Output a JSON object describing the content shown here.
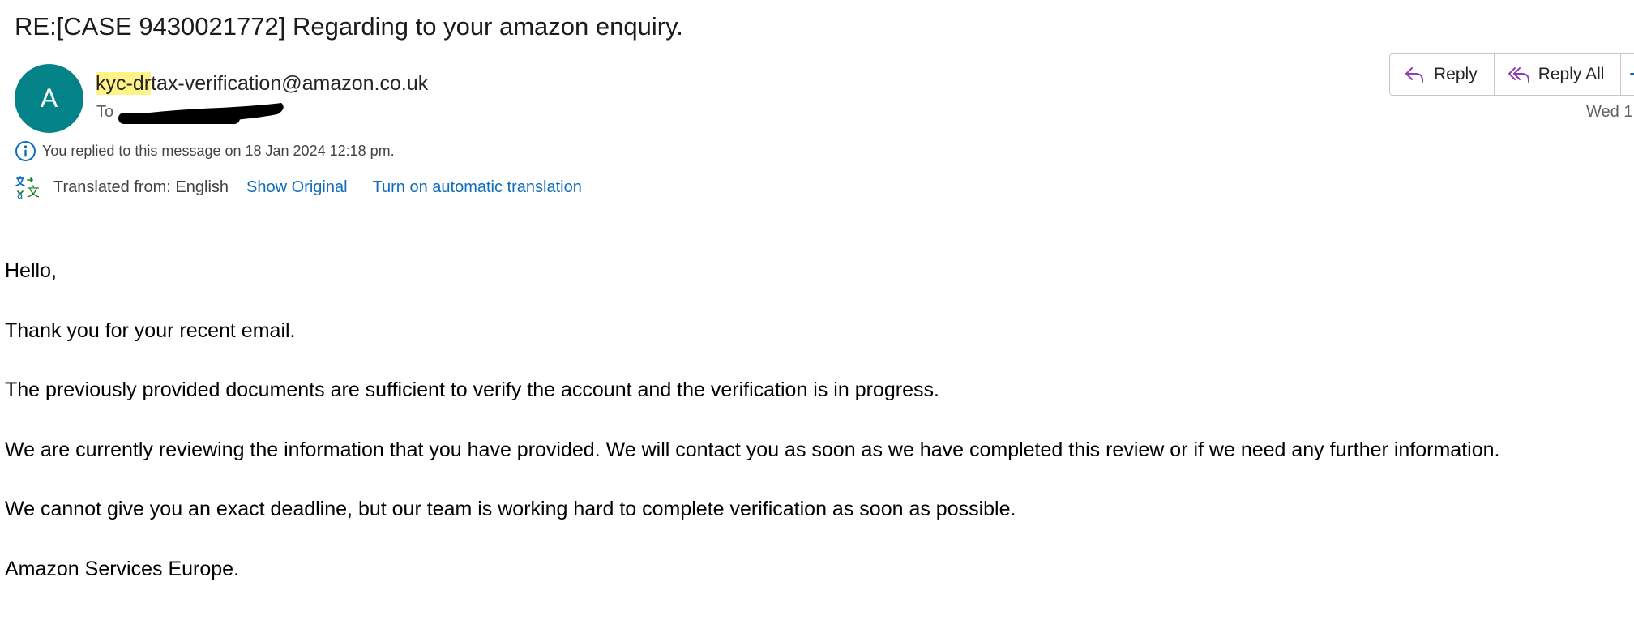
{
  "email": {
    "subject": "RE:[CASE 9430021772] Regarding to your amazon enquiry.",
    "avatar_initial": "A",
    "sender": {
      "highlight": "kyc-dr",
      "rest": "tax-verification@amazon.co.uk"
    },
    "to_label": "To",
    "date": "Wed 1",
    "info": "You replied to this message on 18 Jan 2024 12:18 pm.",
    "translation": {
      "from_label": "Translated from: English",
      "show_original": "Show Original",
      "auto_translate": "Turn on automatic translation"
    },
    "actions": {
      "reply": "Reply",
      "reply_all": "Reply All"
    },
    "body": [
      "Hello,",
      "Thank you for your recent email.",
      "The previously provided documents are sufficient to verify the account and the verification is in progress.",
      "We are currently reviewing the information that you have provided. We will contact you as soon as we have completed this review or if we need any further information.",
      "We cannot give you an exact deadline, but our team is working hard to complete verification as soon as possible.",
      "Amazon Services Europe."
    ]
  },
  "colors": {
    "avatar": "#038387",
    "link": "#0f6cbd",
    "highlight": "#fff287",
    "reply_icon": "#8a3fb5",
    "translate_icon_blue": "#0f6cbd",
    "translate_icon_green": "#107c10"
  },
  "icons": {
    "info": "info-icon",
    "translate": "translate-icon",
    "reply": "reply-icon",
    "reply_all": "reply-all-icon",
    "forward": "forward-icon"
  }
}
